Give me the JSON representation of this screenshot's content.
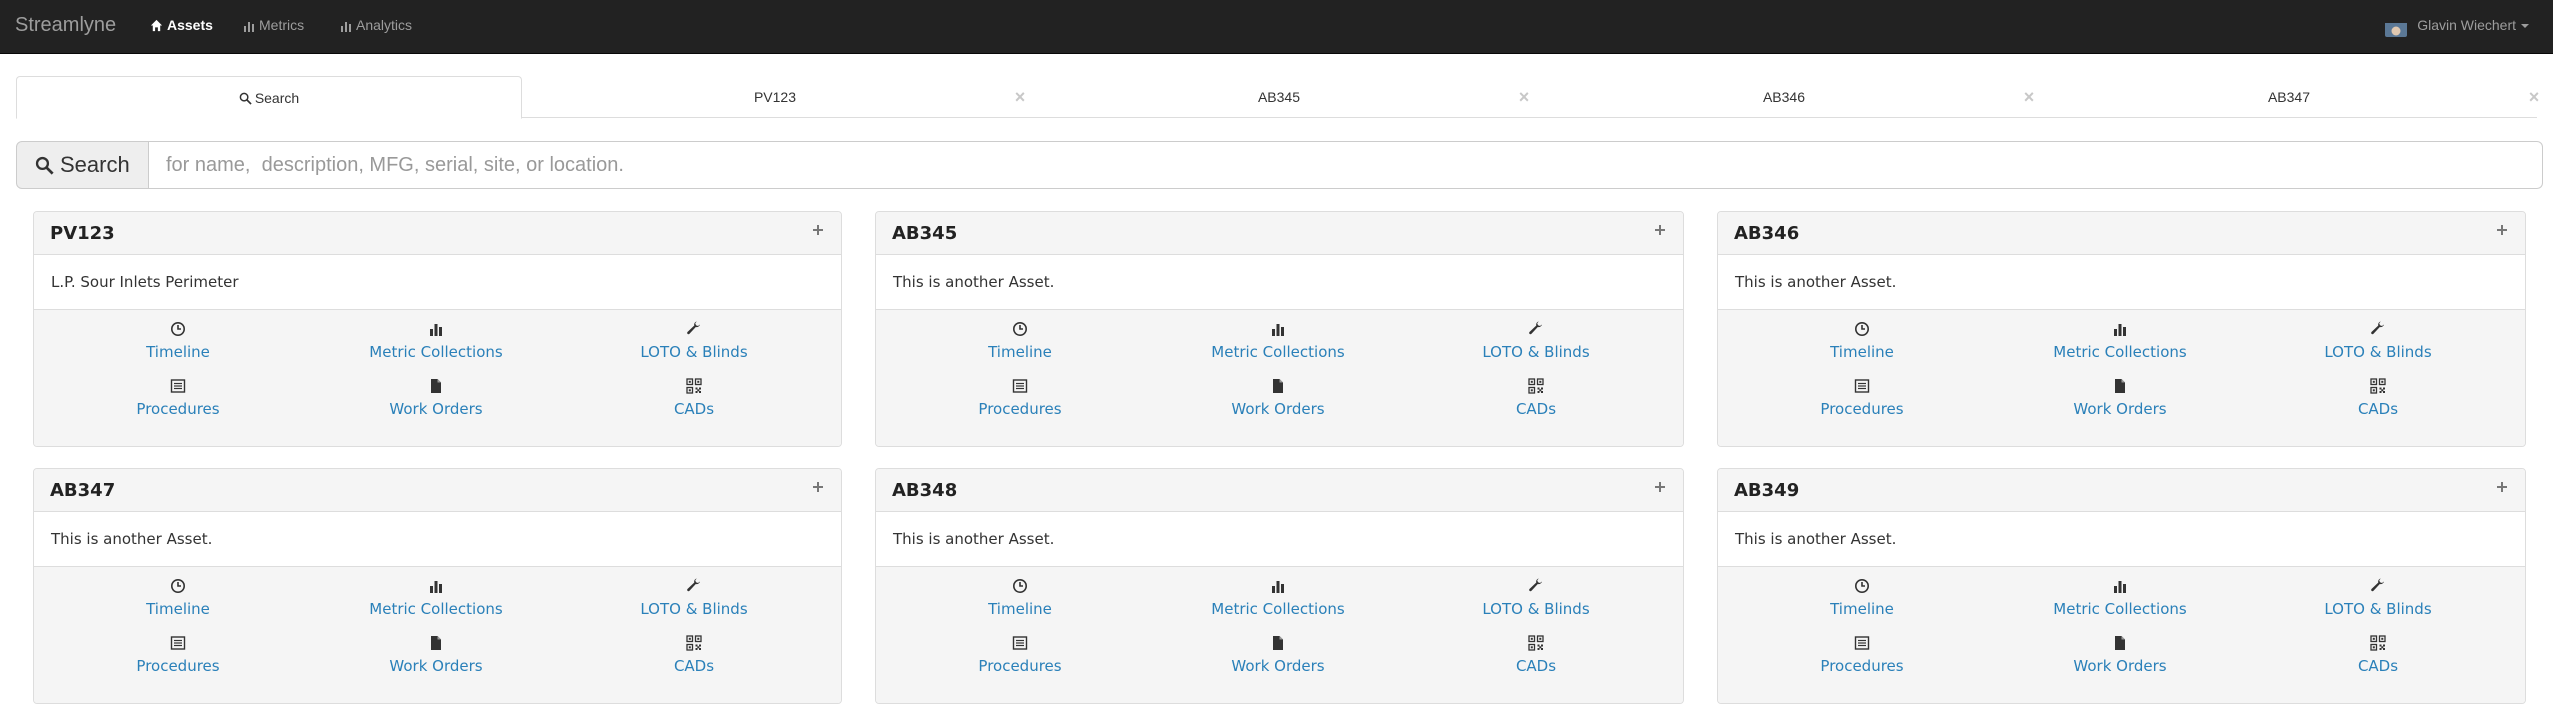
{
  "navbar": {
    "brand": "Streamlyne",
    "links": [
      {
        "label": "Assets",
        "icon": "home-icon",
        "active": true
      },
      {
        "label": "Metrics",
        "icon": "bar-chart-icon",
        "active": false
      },
      {
        "label": "Analytics",
        "icon": "bar-chart-icon",
        "active": false
      }
    ],
    "user": "Glavin Wiechert"
  },
  "tabs": [
    {
      "label": "Search",
      "icon": "search-icon",
      "closable": false,
      "active": true
    },
    {
      "label": "PV123",
      "closable": true
    },
    {
      "label": "AB345",
      "closable": true
    },
    {
      "label": "AB346",
      "closable": true
    },
    {
      "label": "AB347",
      "closable": true
    }
  ],
  "tab_close_glyph": "×",
  "search": {
    "button_label": "Search",
    "placeholder": "for name,  description, MFG, serial, site, or location."
  },
  "link_labels": {
    "timeline": "Timeline",
    "metric_collections": "Metric Collections",
    "loto_blinds": "LOTO & Blinds",
    "procedures": "Procedures",
    "work_orders": "Work Orders",
    "cads": "CADs"
  },
  "assets": [
    {
      "name": "PV123",
      "description": "L.P. Sour Inlets Perimeter"
    },
    {
      "name": "AB345",
      "description": "This is another Asset."
    },
    {
      "name": "AB346",
      "description": "This is another Asset."
    },
    {
      "name": "AB347",
      "description": "This is another Asset."
    },
    {
      "name": "AB348",
      "description": "This is another Asset."
    },
    {
      "name": "AB349",
      "description": "This is another Asset."
    }
  ],
  "colors": {
    "navbar_bg": "#222222",
    "link": "#2a80b9",
    "panel_heading_bg": "#f5f5f5"
  }
}
